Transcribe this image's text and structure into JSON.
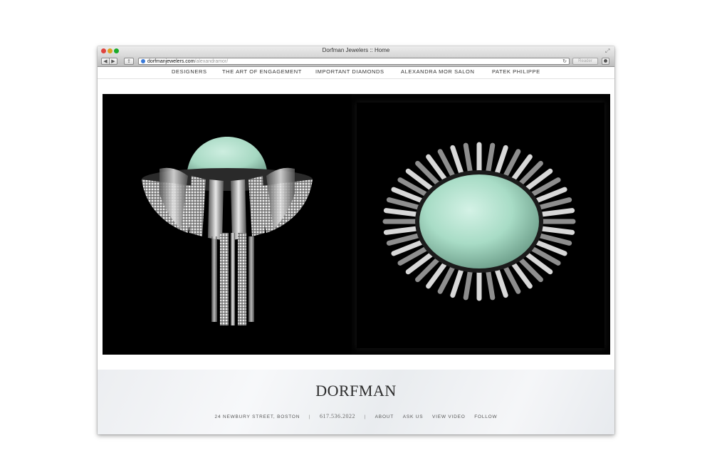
{
  "window": {
    "title": "Dorfman Jewelers :: Home"
  },
  "toolbar": {
    "back_glyph": "◀",
    "forward_glyph": "▶",
    "share_glyph": "⇪",
    "url_domain": "dorfmanjewelers.com",
    "url_path": "/alexandramor/",
    "reload_glyph": "↻",
    "reader_label": "Reader",
    "icons": [
      "globe-icon",
      "reload-icon",
      "download-icon",
      "fullscreen-icon"
    ]
  },
  "nav": {
    "items": [
      {
        "label": "DESIGNERS"
      },
      {
        "label": "THE ART OF ENGAGEMENT"
      },
      {
        "label": "IMPORTANT DIAMONDS"
      },
      {
        "label": "ALEXANDRA MOR SALON"
      },
      {
        "label": "PATEK PHILIPPE"
      }
    ]
  },
  "colors": {
    "gem": "#a8dcc6",
    "metal": "#c9c9c9",
    "background": "#000000"
  },
  "footer": {
    "logo": "DORFMAN",
    "address": "24 NEWBURY STREET, BOSTON",
    "separator": "|",
    "phone": "617.536.2022",
    "links": [
      {
        "label": "ABOUT"
      },
      {
        "label": "ASK US"
      },
      {
        "label": "VIEW VIDEO"
      },
      {
        "label": "FOLLOW"
      }
    ]
  }
}
